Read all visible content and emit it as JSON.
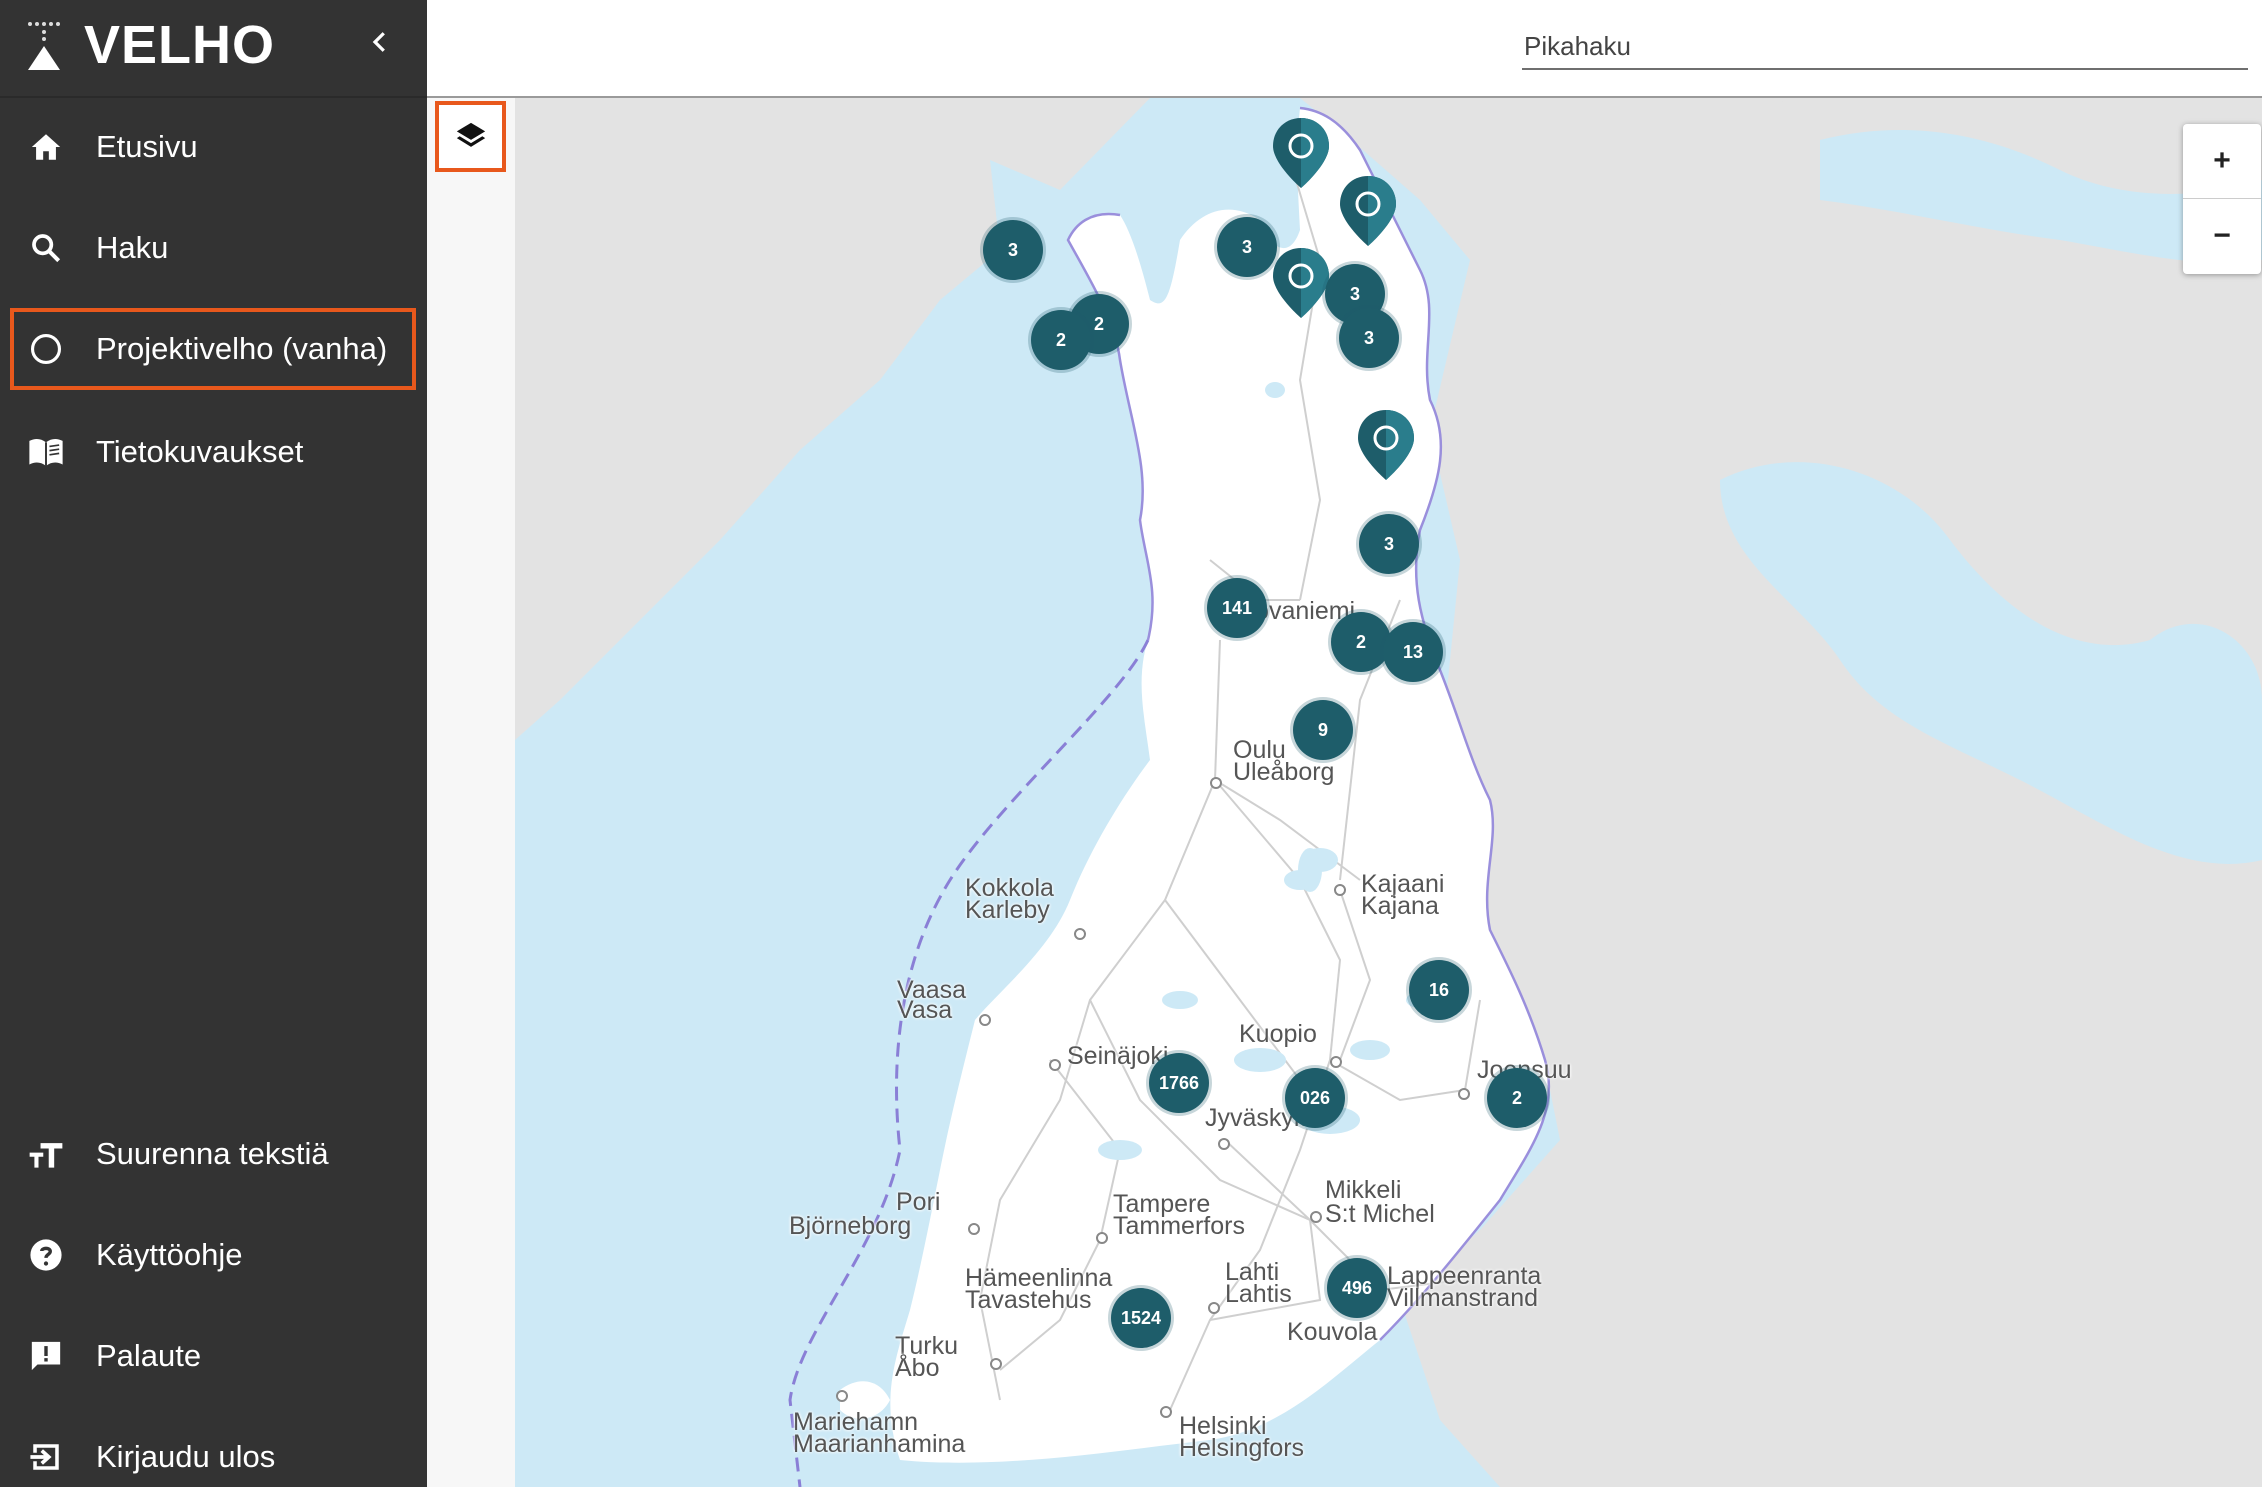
{
  "app": {
    "name": "VELHO"
  },
  "sidebar": {
    "collapse_icon": "chevron-left-icon",
    "top_items": [
      {
        "label": "Etusivu",
        "icon": "home-icon"
      },
      {
        "label": "Haku",
        "icon": "search-icon"
      },
      {
        "label": "Projektivelho (vanha)",
        "icon": "circle-icon",
        "active": true
      },
      {
        "label": "Tietokuvaukset",
        "icon": "book-icon"
      }
    ],
    "bottom_items": [
      {
        "label": "Suurenna tekstiä",
        "icon": "text-size-icon"
      },
      {
        "label": "Käyttöohje",
        "icon": "help-icon"
      },
      {
        "label": "Palaute",
        "icon": "feedback-icon"
      },
      {
        "label": "Kirjaudu ulos",
        "icon": "logout-icon"
      }
    ]
  },
  "header": {
    "search_placeholder": "Pikahaku"
  },
  "map": {
    "layers_icon": "layers-icon",
    "zoom_in": "+",
    "zoom_out": "−",
    "clusters": [
      "3",
      "3",
      "2",
      "2",
      "3",
      "3",
      "3",
      "141",
      "2",
      "13",
      "9",
      "16",
      "1766",
      "026",
      "2",
      "496",
      "1524"
    ],
    "places": [
      "Rovaniemi",
      "Oulu",
      "Uleåborg",
      "Kokkola",
      "Karleby",
      "Kajaani",
      "Kajana",
      "Vaasa",
      "Vasa",
      "Seinäjoki",
      "Kuopio",
      "Jyväskylä",
      "Joensuu",
      "Pori",
      "Björneborg",
      "Tampere",
      "Tammerfors",
      "Mikkeli",
      "S:t Michel",
      "Hämeenlinna",
      "Tavastehus",
      "Lahti",
      "Lahtis",
      "Lappeenranta",
      "Villmanstrand",
      "Kouvola",
      "Turku",
      "Åbo",
      "Mariehamn",
      "Maarianhamina",
      "Helsinki",
      "Helsingfors"
    ],
    "colors": {
      "cluster": "#1e5d6a",
      "water": "#cde9f6",
      "land": "#e6e6e6",
      "finland": "#ffffff",
      "highlight": "#e8581c"
    }
  }
}
